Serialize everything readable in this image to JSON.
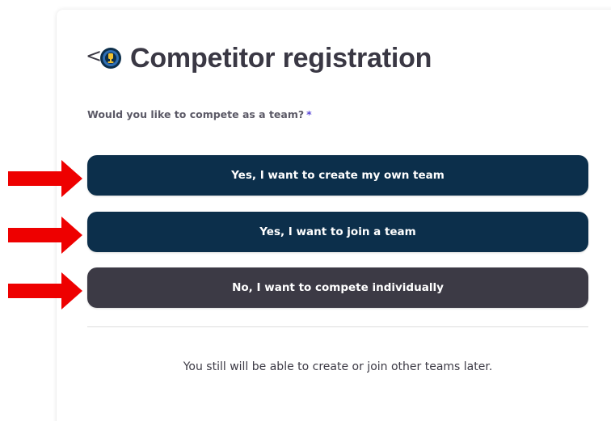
{
  "header": {
    "back_glyph": "<",
    "title": "Competitor registration",
    "logo_icon": "trophy-badge-icon"
  },
  "form": {
    "question": "Would you like to compete as a team?",
    "required_mark": "*",
    "options": [
      {
        "label": "Yes, I want to create my own team",
        "color": "#0c2f4b"
      },
      {
        "label": "Yes, I want to join a team",
        "color": "#0c2f4b"
      },
      {
        "label": "No, I want to compete individually",
        "color": "#3c3a45"
      }
    ],
    "footnote": "You still will be able to create or join other teams later."
  },
  "annotations": {
    "arrow_color": "#ee0000"
  },
  "colors": {
    "title_text": "#3a3844",
    "required_accent": "#5b49d6"
  }
}
